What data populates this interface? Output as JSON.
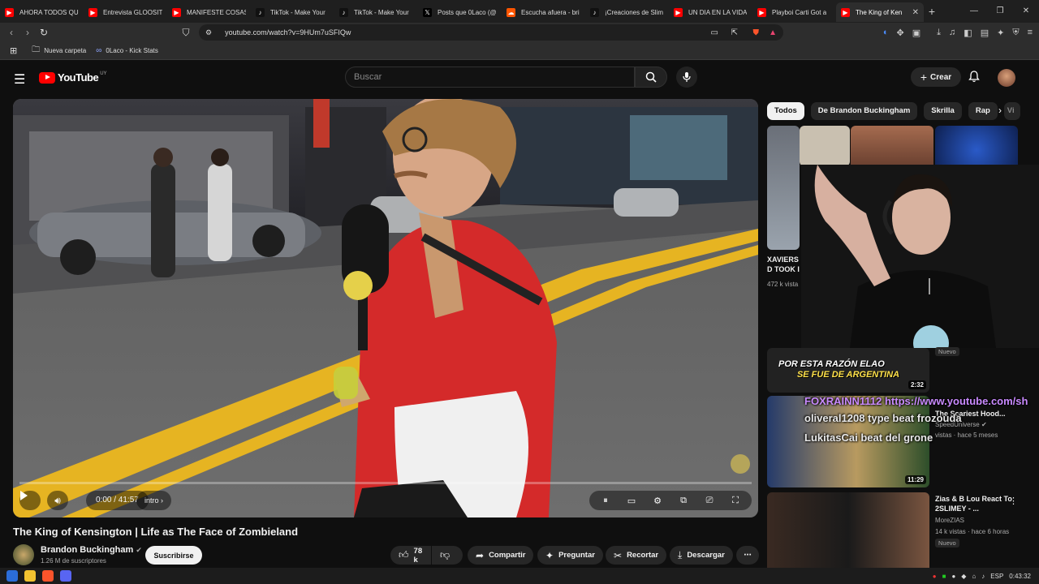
{
  "browser": {
    "tabs": [
      {
        "title": "AHORA TODOS QU",
        "fav": "yt"
      },
      {
        "title": "Entrevista GLOOSIT",
        "fav": "yt"
      },
      {
        "title": "MANIFESTE COSAS",
        "fav": "yt"
      },
      {
        "title": "TikTok - Make Your",
        "fav": "tt"
      },
      {
        "title": "TikTok - Make Your",
        "fav": "tt"
      },
      {
        "title": "Posts que 0Laco (@",
        "fav": "x"
      },
      {
        "title": "Escucha afuera - bri",
        "fav": "sc"
      },
      {
        "title": "¡Creaciones de Slim",
        "fav": "tt"
      },
      {
        "title": "UN DIA EN LA VIDA",
        "fav": "yt"
      },
      {
        "title": "Playboi Carti Got a",
        "fav": "yt"
      },
      {
        "title": "The King of Ken",
        "fav": "yt",
        "active": true
      }
    ],
    "new_tab": "+",
    "url": "youtube.com/watch?v=9HUm7uSFIQw",
    "bookmarks": [
      {
        "label": "Nueva carpeta",
        "icon": "folder-icon"
      },
      {
        "label": "0Laco - Kick Stats",
        "icon": "kick-icon"
      }
    ]
  },
  "masthead": {
    "logo_text": "YouTube",
    "country_code": "UY",
    "search_placeholder": "Buscar",
    "create_label": "Crear"
  },
  "player": {
    "time": "0:00 / 41:57",
    "chapter": "intro"
  },
  "video": {
    "title": "The King of Kensington | Life as The Face of Zombieland",
    "channel": "Brandon Buckingham",
    "subscribers": "1.26 M de suscriptores",
    "subscribe_label": "Suscribirse",
    "likes": "78 k",
    "share_label": "Compartir",
    "ask_label": "Preguntar",
    "clip_label": "Recortar",
    "download_label": "Descargar"
  },
  "chips": [
    "Todos",
    "De Brandon Buckingham",
    "Skrilla",
    "Rap",
    "Vi"
  ],
  "recommendations": [
    {
      "title": "XAVIERS D TOOK I",
      "meta": "472 k vista"
    },
    {
      "title": "",
      "meta": "",
      "badge": "Nuevo",
      "duration": "2:32",
      "thumb_text_1": "POR ESTA RAZÓN ELAO",
      "thumb_text_2": "SE FUE DE ARGENTINA"
    },
    {
      "title": "The Scariest Hood...",
      "channel": "SpeedUniverse",
      "meta": "vistas · hace 5 meses",
      "duration": "11:29"
    },
    {
      "title": "Zias & B Lou React To 2SLIMEY - ...",
      "channel": "MoreZIAS",
      "meta": "14 k vistas · hace 6 horas",
      "badge": "Nuevo"
    }
  ],
  "chat_overlay": [
    "FOXRAINN1112 https://www.youtube.com/sh",
    "oliveral1208 type beat frozouda",
    "LukitasCai beat del grone"
  ],
  "taskbar": {
    "lang": "ESP",
    "clock": "0:43:32"
  },
  "colors": {
    "bg": "#0f0f0f",
    "youtube_red": "#ff0000",
    "chip_active": "#f1f1f1",
    "surface": "#272727"
  }
}
